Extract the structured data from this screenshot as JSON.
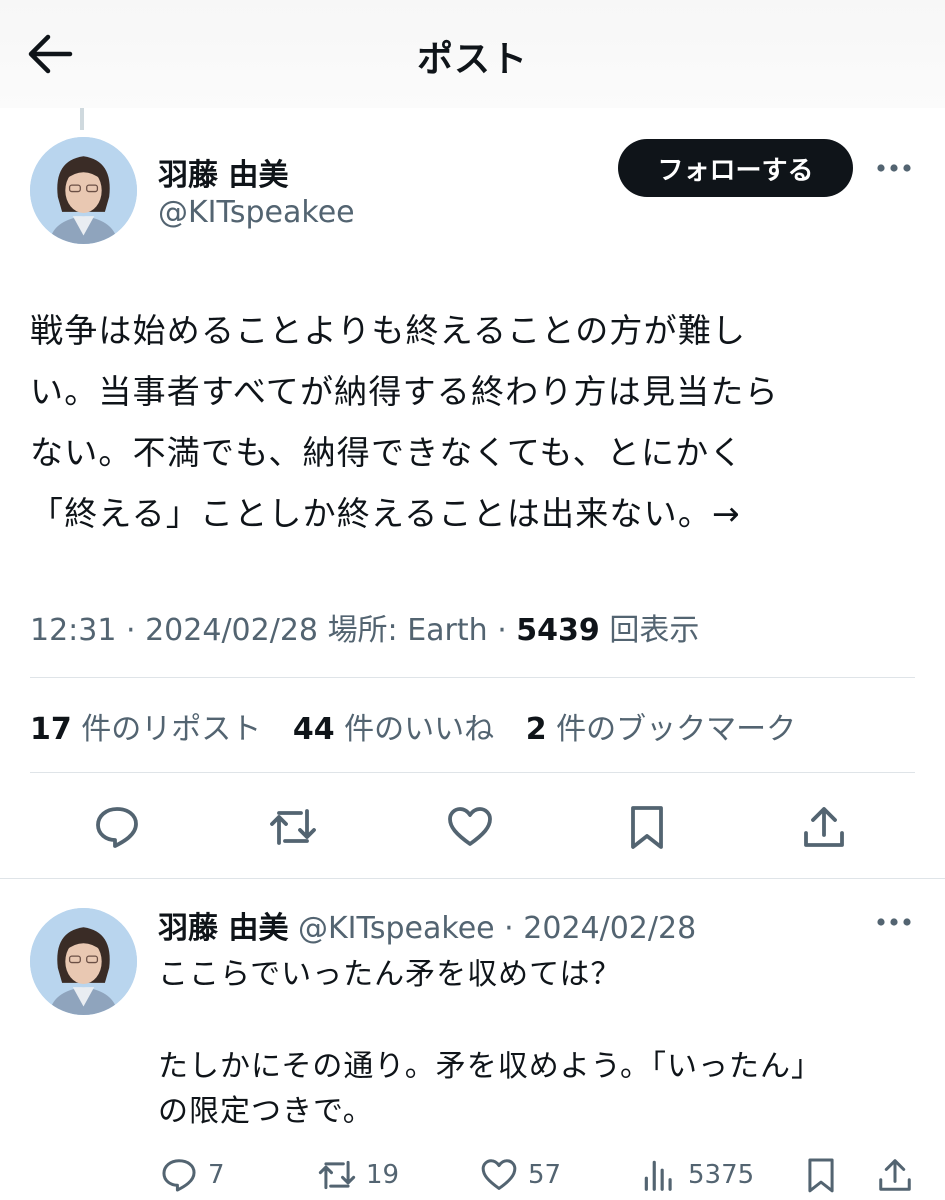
{
  "header": {
    "title": "ポスト",
    "back_icon": "arrow-left-icon"
  },
  "post": {
    "author_name": "羽藤 由美",
    "author_handle": "@KITspeakee",
    "follow_label": "フォローする",
    "text_lines": [
      "戦争は始めることよりも終えることの方が難し",
      "い。当事者すべてが納得する終わり方は見当たら",
      "ない。不満でも、納得できなくても、とにかく",
      "「終える」ことしか終えることは出来ない。→"
    ],
    "time": "12:31",
    "date": "2024/02/28",
    "location_label": "場所: Earth",
    "views_count": "5439",
    "views_label": "回表示",
    "reposts_count": "17",
    "reposts_label": "件のリポスト",
    "likes_count": "44",
    "likes_label": "件のいいね",
    "bookmarks_count": "2",
    "bookmarks_label": "件のブックマーク"
  },
  "reply": {
    "author_name": "羽藤 由美",
    "author_handle": "@KITspeakee",
    "date": "2024/02/28",
    "line1": "ここらでいったん矛を収めては？",
    "line2": "たしかにその通り。矛を収めよう。「いったん」",
    "line3": "の限定つきで。",
    "replies": "7",
    "reposts": "19",
    "likes": "57",
    "views": "5375"
  },
  "colors": {
    "text": "#0f1419",
    "secondary": "#536471",
    "divider": "#dfe4e8",
    "button": "#0f1419"
  }
}
